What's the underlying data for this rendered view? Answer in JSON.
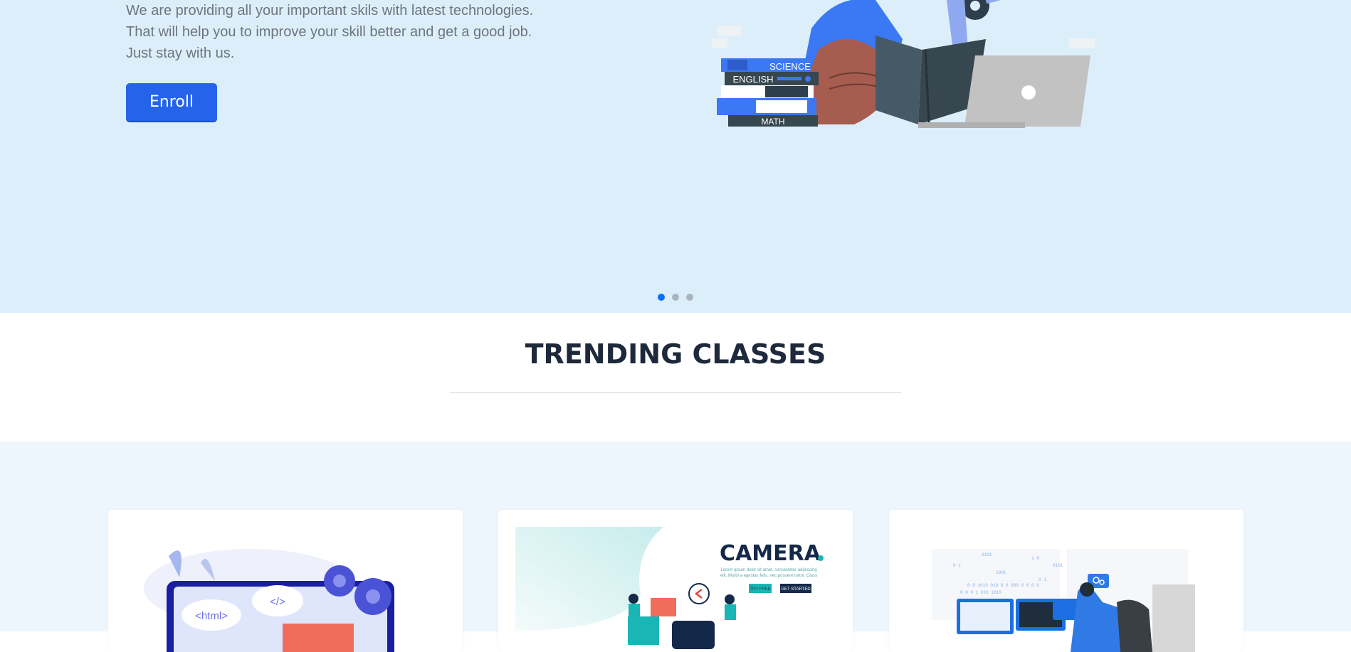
{
  "hero": {
    "lines": [
      "We are providing all your important skils with latest technologies.",
      "That will help you to improve your skill better and get a good job.",
      "Just stay with us."
    ],
    "enroll_label": "Enroll",
    "book_labels": [
      "SCIENCE",
      "ENGLISH",
      "MATH"
    ],
    "carousel": {
      "count": 3,
      "active": 1
    }
  },
  "trending": {
    "title": "TRENDING CLASSES"
  },
  "cards": [
    {
      "icon": "web-development-illustration",
      "tags": [
        "<html>",
        "</>"
      ]
    },
    {
      "icon": "camera-illustration",
      "heading": "CAMERA",
      "lorem": [
        "Lorem ipsum dolor sit amet, consectetur adipiscing",
        "elit. Morbi a egestas felis, nec posuere tortor. Class"
      ],
      "btn1": "TRY FREE",
      "btn2": "GET STARTED"
    },
    {
      "icon": "programmer-workspace-illustration"
    }
  ],
  "colors": {
    "hero_bg": "#ddeefb",
    "accent": "#2563eb",
    "classes_bg": "#eef6fd"
  }
}
